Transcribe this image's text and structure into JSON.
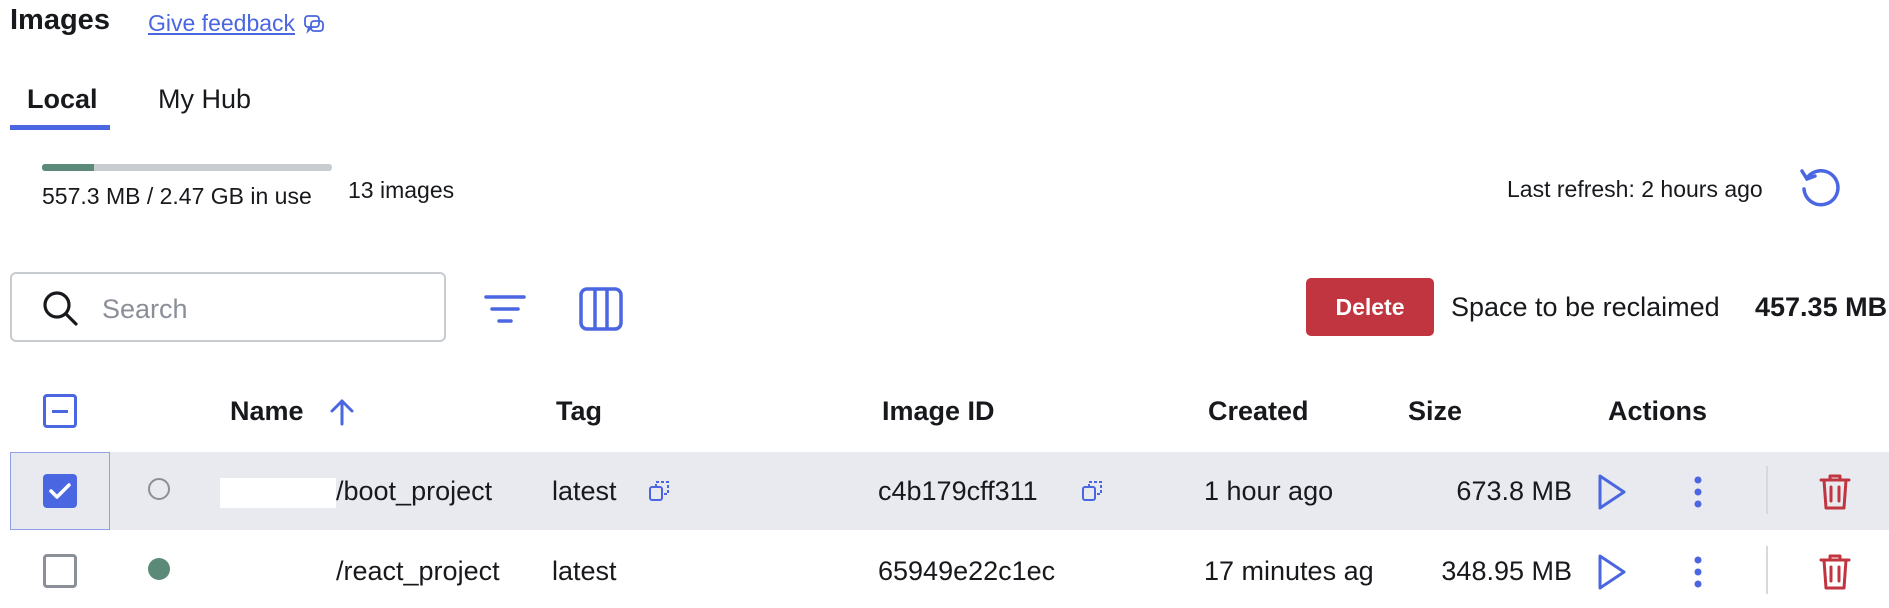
{
  "header": {
    "title": "Images",
    "feedback_label": "Give feedback"
  },
  "tabs": [
    {
      "label": "Local",
      "active": true
    },
    {
      "label": "My Hub",
      "active": false
    }
  ],
  "usage": {
    "text": "557.3 MB / 2.47 GB in use",
    "fraction_used": 0.18,
    "image_count": "13 images",
    "last_refresh": "Last refresh: 2 hours ago"
  },
  "toolbar": {
    "search_placeholder": "Search",
    "delete_label": "Delete",
    "reclaim_label": "Space to be reclaimed",
    "reclaim_value": "457.35 MB"
  },
  "table": {
    "columns": [
      "Name",
      "Tag",
      "Image ID",
      "Created",
      "Size",
      "Actions"
    ],
    "rows": [
      {
        "name": "/boot_project",
        "tag": "latest",
        "image_id": "c4b179cff311",
        "created": "1 hour ago",
        "size": "673.8 MB",
        "selected": true,
        "in_use": false
      },
      {
        "name": "/react_project",
        "tag": "latest",
        "image_id": "65949e22c1ec",
        "created": "17 minutes ag",
        "size": "348.95 MB",
        "selected": false,
        "in_use": true
      }
    ]
  },
  "colors": {
    "accent": "#4a66e0",
    "danger": "#c0353f",
    "in_use": "#5b8a79",
    "selected_row": "#e9eaef"
  },
  "icons": [
    "feedback-icon",
    "refresh-icon",
    "search-icon",
    "filter-icon",
    "columns-icon",
    "sort-ascending-icon",
    "copy-icon",
    "play-icon",
    "more-vertical-icon",
    "trash-icon"
  ]
}
